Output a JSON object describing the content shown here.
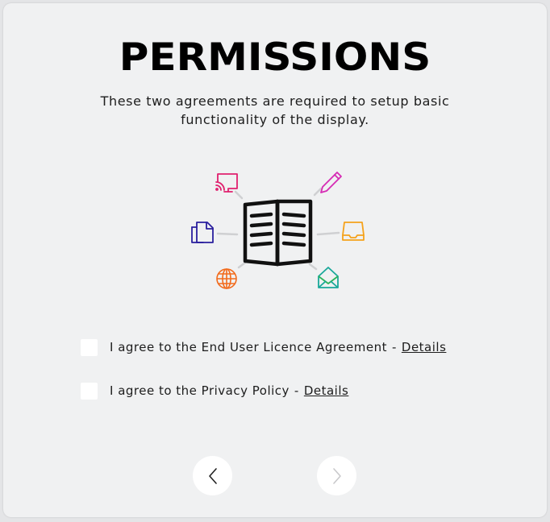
{
  "header": {
    "title": "PERMISSIONS",
    "subtitle": "These two agreements are required to setup basic functionality of the display."
  },
  "illustration": {
    "center_icon": "open-book-icon",
    "satellite_icons": [
      "cast-screen-icon",
      "pencil-icon",
      "documents-icon",
      "inbox-tray-icon",
      "globe-icon",
      "open-envelope-icon"
    ],
    "colors": {
      "cast": "#e0206e",
      "pencil": "#d62bb4",
      "documents": "#2a1f9e",
      "inbox": "#f5a21b",
      "globe": "#f26a1b",
      "envelope": "#1aa89a",
      "connector": "#cfd0d2"
    }
  },
  "agreements": [
    {
      "text": "I agree to the End User Licence Agreement",
      "separator": "-",
      "link": "Details",
      "checked": false
    },
    {
      "text": "I agree to the Privacy Policy",
      "separator": "-",
      "link": "Details",
      "checked": false
    }
  ],
  "nav": {
    "back_icon": "chevron-left-icon",
    "next_icon": "chevron-right-icon",
    "next_enabled": false
  },
  "theme": {
    "card_bg": "#f0f1f2",
    "page_bg": "#e4e5e7",
    "text": "#1d1d1d"
  }
}
